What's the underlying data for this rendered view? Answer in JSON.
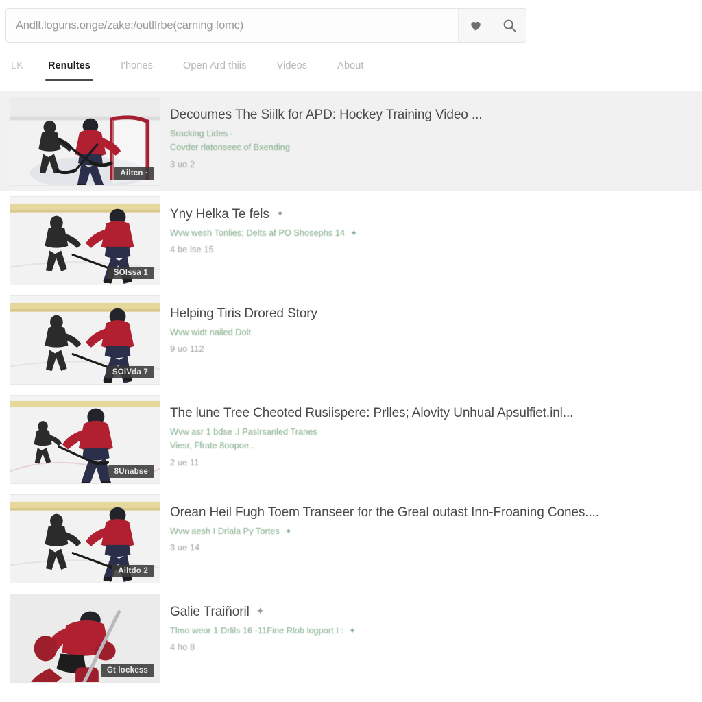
{
  "search": {
    "value": "Andlt.loguns.onge/zake:/outlIrbe(carning fomc)",
    "placeholder": "Andlt.loguns.onge/zake:/outlIrbe(carning fomc)",
    "favorite_icon": "heart-icon",
    "search_icon": "search-icon"
  },
  "tabs": [
    {
      "label": "LK",
      "active": false
    },
    {
      "label": "Renultes",
      "active": true
    },
    {
      "label": "I'hones",
      "active": false
    },
    {
      "label": "Open Ard thiis",
      "active": false
    },
    {
      "label": "Videos",
      "active": false
    },
    {
      "label": "About",
      "active": false
    }
  ],
  "results": [
    {
      "title": "Decoumes The Siilk for APD: Hockey Training Video ...",
      "title_star": "",
      "sub1": "Sracking Lides -",
      "sub1_star": "",
      "sub2": "Covder rlatonseec of Bxending",
      "meta": "3 uo 2",
      "badge": "Ailtcn ·",
      "highlight": true,
      "scene": "two-players-net"
    },
    {
      "title": "Yny Helka Te fels",
      "title_star": "✦",
      "sub1": "Wvw wesh Tonlies; Delts af PO Shosephs 14",
      "sub1_star": "✦",
      "sub2": "",
      "meta": "4 be lse 15",
      "badge": "SOlssa 1",
      "highlight": false,
      "scene": "coach-and-player"
    },
    {
      "title": "Helping Tiris Drored Story",
      "title_star": "",
      "sub1": "Wvw widt nailed Dolt",
      "sub1_star": "",
      "sub2": "",
      "meta": "9 uo 112",
      "badge": "SOlVda 7",
      "highlight": false,
      "scene": "coach-and-player"
    },
    {
      "title": "The lune Tree Cheoted Rusiispere: Prlles; Alovity Unhual Apsulfiet.inl...",
      "title_star": "",
      "sub1": "Wvw asr 1 bdse .I Paslrsanled Tranes",
      "sub1_star": "",
      "sub2": "Viesr, Ffrate 8oopoe..",
      "meta": "2 ue 11",
      "badge": "8Unabse",
      "highlight": false,
      "scene": "skater-wide"
    },
    {
      "title": "Orean Heil Fugh Toem Transeer for the Greal outast Inn-Froaning Cones....",
      "title_star": "",
      "sub1": "Wvw aesh I Drlala Py Tortes",
      "sub1_star": "✦",
      "sub2": "",
      "meta": "3 ue 14",
      "badge": "Ailtdo 2",
      "highlight": false,
      "scene": "coach-and-player"
    },
    {
      "title": "Galie Traiñoril",
      "title_star": "✦",
      "sub1": "Tlmo weor 1 Drlils 16 -11Fine Rlob logport I :",
      "sub1_star": "✦",
      "sub2": "",
      "meta": "4 ho 8",
      "badge": "Gt lockess",
      "highlight": false,
      "scene": "goalie"
    }
  ],
  "colors": {
    "rink_board": "#e6d79a",
    "ice": "#f2f2f2",
    "jersey_red": "#b02030",
    "coach_black": "#2b2b2b",
    "highlight_row": "#f1f1f1",
    "subtext_green": "#7faa86"
  }
}
